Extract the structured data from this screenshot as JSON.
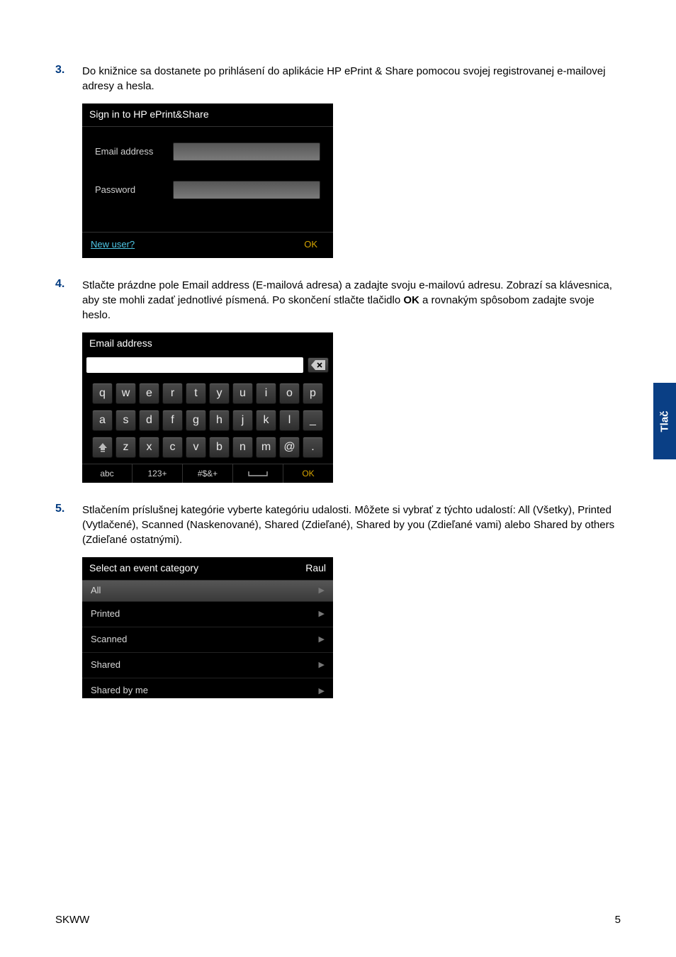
{
  "steps": {
    "s3": {
      "num": "3.",
      "text": "Do knižnice sa dostanete po prihlásení do aplikácie HP ePrint & Share pomocou svojej registrovanej e-mailovej adresy a hesla."
    },
    "s4": {
      "num": "4.",
      "text_a": "Stlačte prázdne pole Email address (E-mailová adresa) a zadajte svoju e-mailovú adresu. Zobrazí sa klávesnica, aby ste mohli zadať jednotlivé písmená. Po skončení stlačte tlačidlo ",
      "text_bold": "OK",
      "text_b": " a rovnakým spôsobom zadajte svoje heslo."
    },
    "s5": {
      "num": "5.",
      "text": "Stlačením príslušnej kategórie vyberte kategóriu udalosti. Môžete si vybrať z týchto udalostí: All (Všetky), Printed (Vytlačené), Scanned (Naskenované), Shared (Zdieľané), Shared by you (Zdieľané vami) alebo Shared by others (Zdieľané ostatnými)."
    }
  },
  "signin": {
    "title": "Sign in to HP ePrint&Share",
    "email_label": "Email address",
    "password_label": "Password",
    "new_user": "New user?",
    "ok": "OK"
  },
  "keyboard": {
    "title": "Email address",
    "row1": [
      "q",
      "w",
      "e",
      "r",
      "t",
      "y",
      "u",
      "i",
      "o",
      "p"
    ],
    "row2": [
      "a",
      "s",
      "d",
      "f",
      "g",
      "h",
      "j",
      "k",
      "l",
      "_"
    ],
    "row3_tail": [
      "z",
      "x",
      "c",
      "v",
      "b",
      "n",
      "m",
      "@",
      "."
    ],
    "abc": "abc",
    "num": "123+",
    "sym": "#$&+",
    "ok": "OK"
  },
  "categories": {
    "title": "Select an event category",
    "user": "Raul",
    "items": [
      "All",
      "Printed",
      "Scanned",
      "Shared",
      "Shared by me"
    ]
  },
  "side_tab": "Tlač",
  "footer_left": "SKWW",
  "footer_right": "5"
}
